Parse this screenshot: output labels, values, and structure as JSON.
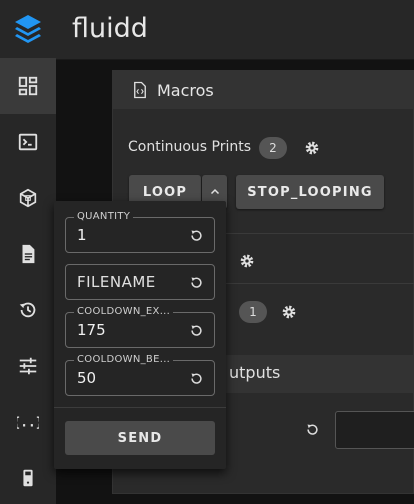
{
  "app": {
    "title": "fluidd",
    "accent": "#2196f3"
  },
  "sidebar": {
    "items": [
      {
        "icon": "dashboard-icon",
        "active": true
      },
      {
        "icon": "console-icon"
      },
      {
        "icon": "cube-icon"
      },
      {
        "icon": "file-document-icon"
      },
      {
        "icon": "history-icon"
      },
      {
        "icon": "tune-icon"
      },
      {
        "icon": "code-braces-icon"
      },
      {
        "icon": "device-icon"
      }
    ]
  },
  "macros": {
    "title": "Macros",
    "categories": [
      {
        "label": "Continuous Prints",
        "count": "2"
      },
      {
        "label": "",
        "count": ""
      },
      {
        "label": "",
        "count": "1"
      }
    ],
    "buttons": {
      "loop": "LOOP",
      "stop_looping": "STOP_LOOPING"
    }
  },
  "outputs": {
    "title_fragment": "utputs"
  },
  "popup": {
    "fields": [
      {
        "label": "QUANTITY",
        "value": "1"
      },
      {
        "placeholder": "FILENAME"
      },
      {
        "label": "COOLDOWN_EX...",
        "value": "175"
      },
      {
        "label": "COOLDOWN_BE...",
        "value": "50"
      }
    ],
    "send": "SEND"
  }
}
